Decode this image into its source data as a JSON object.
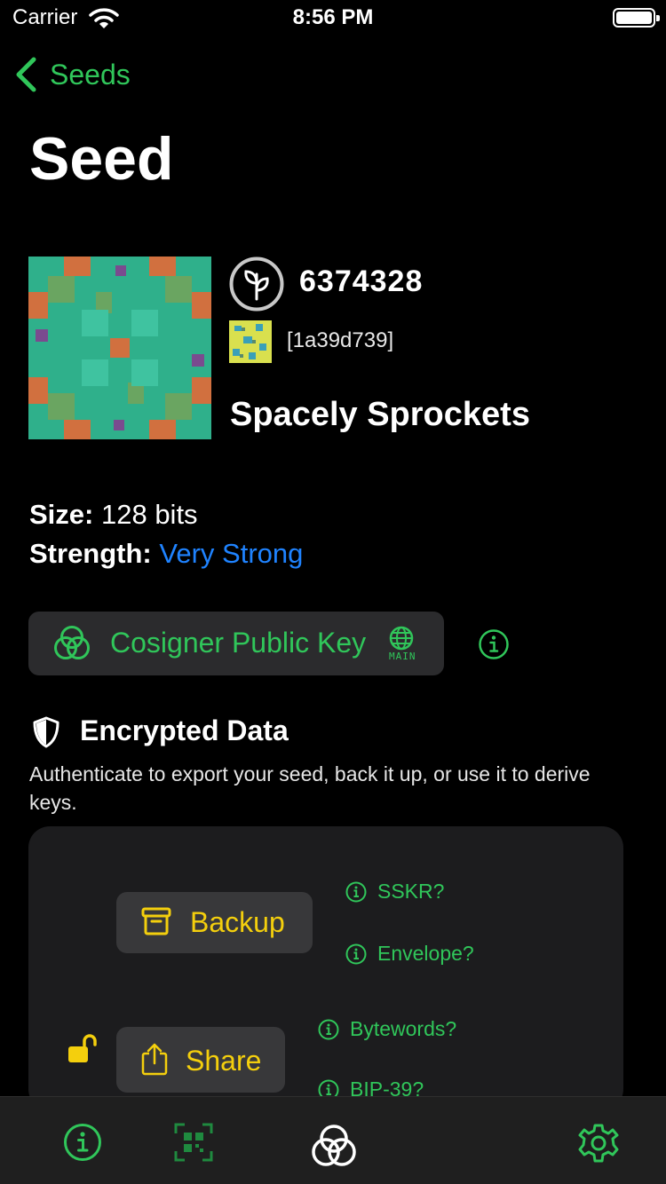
{
  "status_bar": {
    "carrier": "Carrier",
    "time": "8:56 PM"
  },
  "nav": {
    "back_label": "Seeds",
    "title": "Seed"
  },
  "seed": {
    "id": "6374328",
    "fingerprint": "[1a39d739]",
    "name": "Spacely Sprockets"
  },
  "details": {
    "size_label": "Size:",
    "size_value": "128 bits",
    "strength_label": "Strength:",
    "strength_value": "Very Strong"
  },
  "cosigner": {
    "label": "Cosigner Public Key",
    "network": "MAIN"
  },
  "encrypted": {
    "title": "Encrypted Data",
    "description": "Authenticate to export your seed, back it up, or use it to derive keys.",
    "backup_label": "Backup",
    "share_label": "Share",
    "links": {
      "sskr": "SSKR?",
      "envelope": "Envelope?",
      "bytewords": "Bytewords?",
      "bip39": "BIP-39?"
    }
  },
  "tab_bar": {
    "items": [
      "info-icon",
      "qr-scan-icon",
      "blockchain-commons-icon",
      "settings-icon"
    ]
  },
  "colors": {
    "accent": "#30c65a",
    "link": "#1f83ff",
    "action": "#f4cf0d",
    "background": "#000000"
  }
}
